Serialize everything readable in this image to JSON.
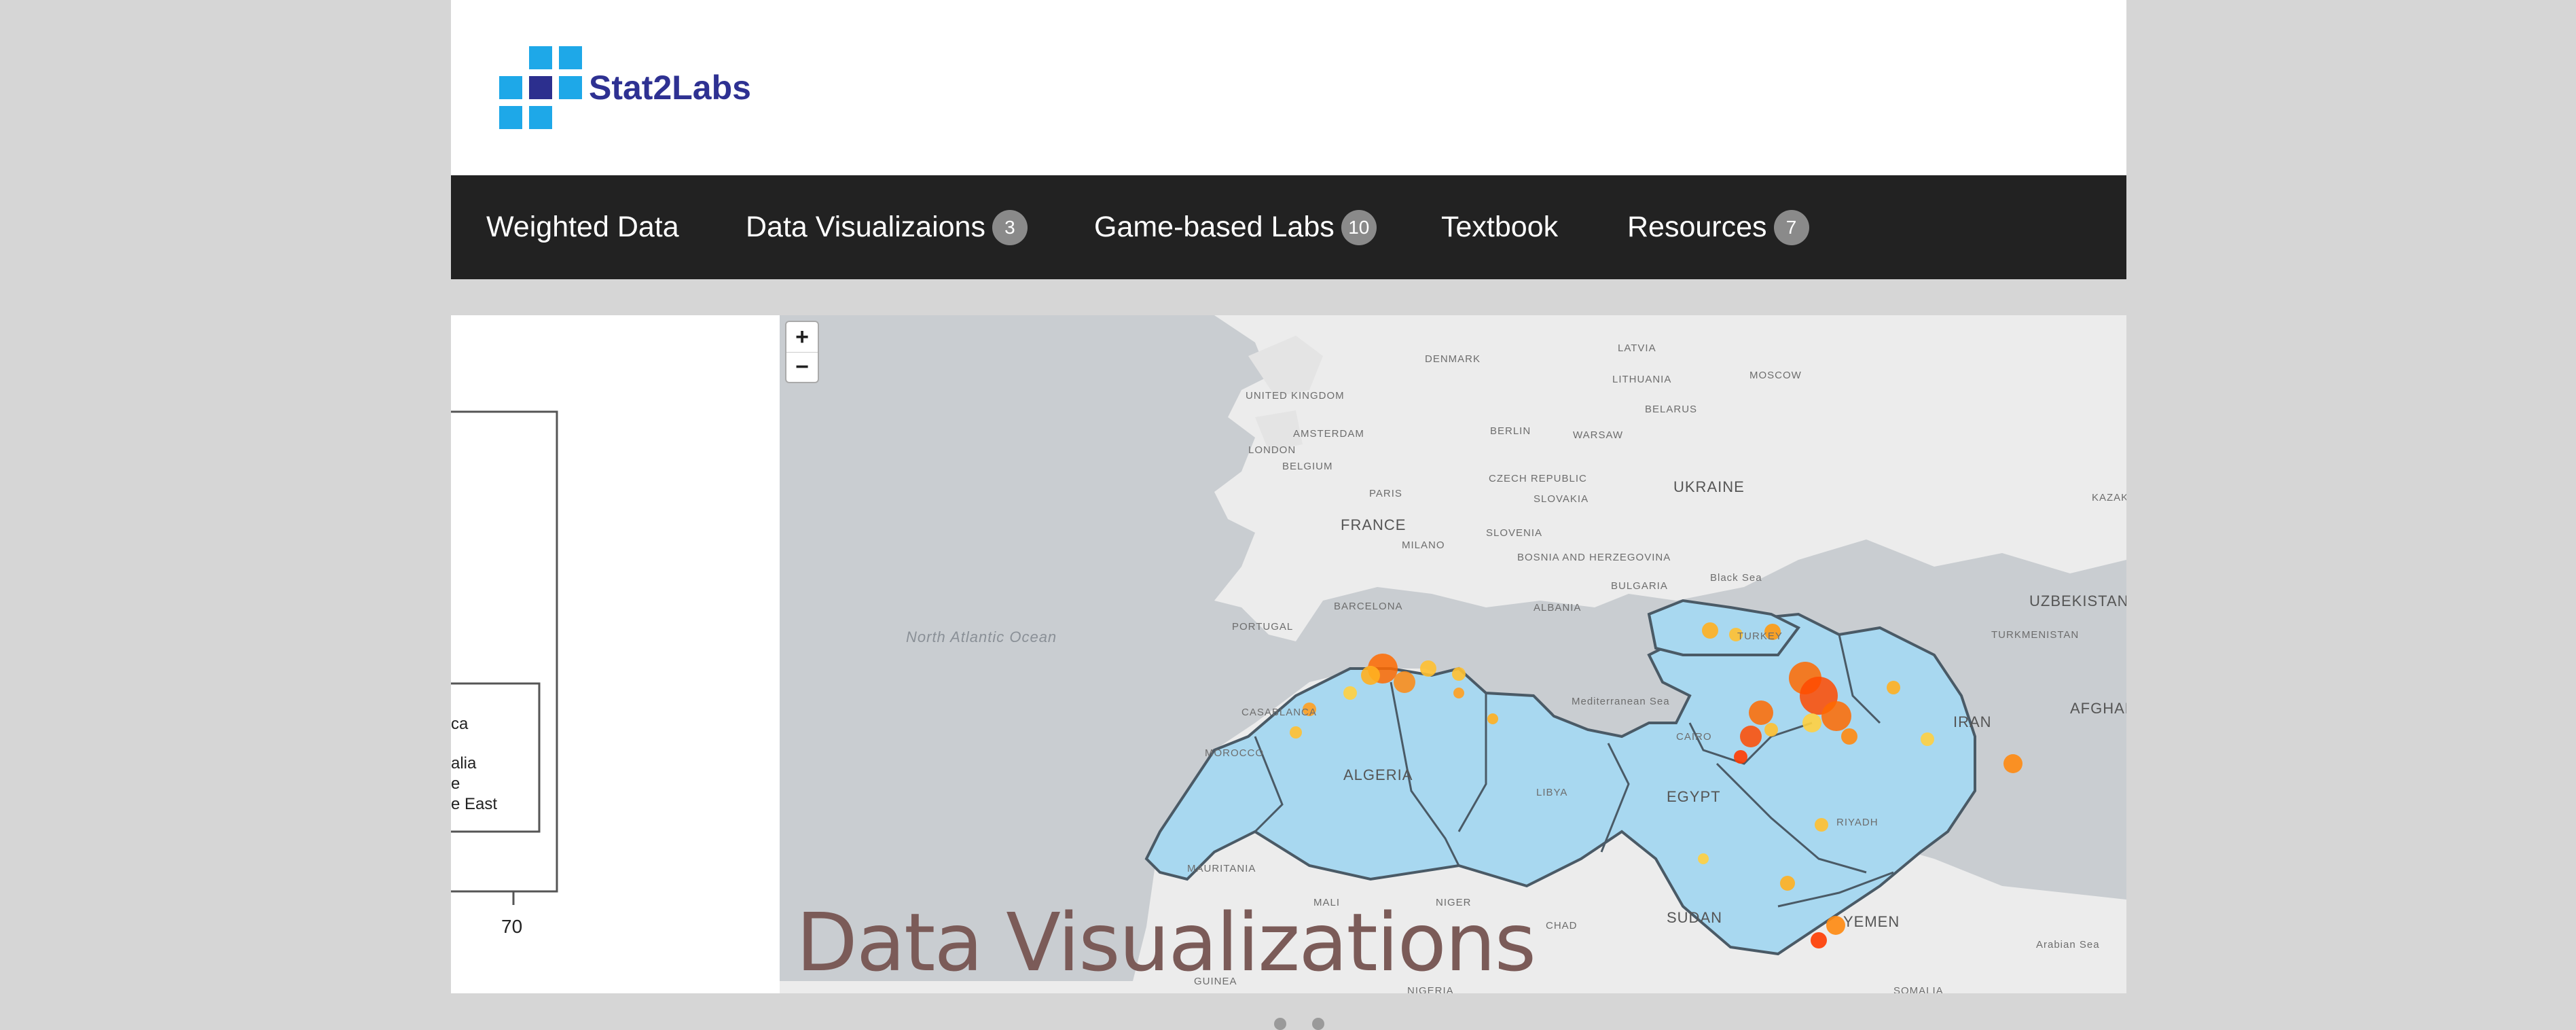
{
  "brand": {
    "name": "Stat2Labs"
  },
  "nav": [
    {
      "label": "Weighted Data",
      "badge": null
    },
    {
      "label": "Data Visualizaions",
      "badge": "3"
    },
    {
      "label": "Game-based Labs",
      "badge": "10"
    },
    {
      "label": "Textbook",
      "badge": null
    },
    {
      "label": "Resources",
      "badge": "7"
    }
  ],
  "carousel": {
    "previous_slide": {
      "legend": [
        "ca",
        "alia",
        "e",
        "e East"
      ],
      "axis_tick": "70"
    },
    "slide": {
      "caption": "Data Visualizations",
      "zoom_in": "+",
      "zoom_out": "−",
      "map_labels": {
        "countries": [
          "UNITED KINGDOM",
          "FRANCE",
          "UKRAINE",
          "ALGERIA",
          "EGYPT",
          "IRAN",
          "UZBEKISTAN",
          "SUDAN",
          "LIBYA",
          "DENMARK",
          "LATVIA",
          "LITHUANIA",
          "BELARUS",
          "CZECH REPUBLIC",
          "SLOVAKIA",
          "SLOVENIA",
          "BOSNIA AND HERZEGOVINA",
          "BULGARIA",
          "ALBANIA",
          "PORTUGAL",
          "MOROCCO",
          "MAURITANIA",
          "MALI",
          "NIGER",
          "CHAD",
          "NIGERIA",
          "GUINEA",
          "YEMEN",
          "SOMALIA",
          "TURKMENISTAN",
          "AFGHANI",
          "KAZAK",
          "BELGIUM",
          "TURKEY"
        ],
        "cities": [
          "AMSTERDAM",
          "LONDON",
          "PARIS",
          "BERLIN",
          "WARSAW",
          "MOSCOW",
          "MILANO",
          "BARCELONA",
          "CASABLANCA",
          "RIYADH",
          "CAIRO"
        ],
        "seas": [
          "North Atlantic Ocean",
          "Black Sea",
          "Mediterranean Sea",
          "Arabian Sea"
        ]
      }
    }
  },
  "colors": {
    "nav_bg": "#222222",
    "map_land_highlight": "#a8d8f0",
    "heat_hot": "#ff3b00",
    "heat_warm": "#ffd84a",
    "brand_blue": "#1ea8e8",
    "brand_navy": "#2e3192"
  }
}
